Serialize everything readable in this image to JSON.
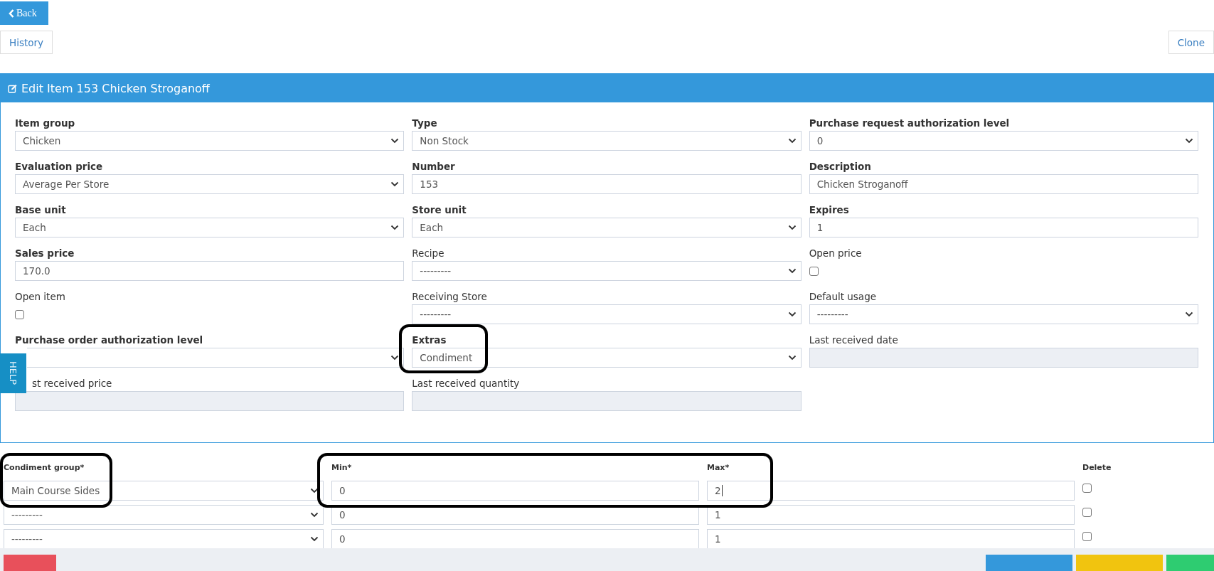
{
  "back_button": {
    "label": "Back"
  },
  "top_actions": [
    {
      "label": "History"
    },
    {
      "label": "Clone"
    }
  ],
  "panel": {
    "title": "Edit Item 153 Chicken Stroganoff",
    "fields": [
      {
        "label": "Item group",
        "required": true,
        "kind": "select",
        "value": "Chicken"
      },
      {
        "label": "Type",
        "required": true,
        "kind": "select",
        "value": "Non Stock"
      },
      {
        "label": "Purchase request authorization level",
        "required": true,
        "kind": "select",
        "value": "0"
      },
      {
        "label": "Evaluation price",
        "required": true,
        "kind": "select",
        "value": "Average Per Store"
      },
      {
        "label": "Number",
        "required": true,
        "kind": "text",
        "value": "153"
      },
      {
        "label": "Description",
        "required": true,
        "kind": "text",
        "value": "Chicken Stroganoff"
      },
      {
        "label": "Base unit",
        "required": true,
        "kind": "select",
        "value": "Each"
      },
      {
        "label": "Store unit",
        "required": true,
        "kind": "select",
        "value": "Each"
      },
      {
        "label": "Expires",
        "required": true,
        "kind": "text",
        "value": "1"
      },
      {
        "label": "Sales price",
        "required": true,
        "kind": "text",
        "value": "170.0"
      },
      {
        "label": "Recipe",
        "required": false,
        "kind": "select",
        "value": "---------"
      },
      {
        "label": "Open price",
        "required": false,
        "kind": "checkbox",
        "checked": false
      },
      {
        "label": "Open item",
        "required": false,
        "kind": "checkbox",
        "checked": false
      },
      {
        "label": "Receiving Store",
        "required": false,
        "kind": "select",
        "value": "---------"
      },
      {
        "label": "Default usage",
        "required": false,
        "kind": "select",
        "value": "---------"
      },
      {
        "label": "Purchase order authorization level",
        "required": true,
        "kind": "select"
      },
      {
        "label": "Extras",
        "required": true,
        "kind": "select",
        "value": "Condiment",
        "highlighted": true
      },
      {
        "label": "Last received date",
        "required": false,
        "kind": "readonly"
      },
      {
        "label": "st received price",
        "required": false,
        "kind": "readonly"
      },
      {
        "label": "Last received quantity",
        "required": false,
        "kind": "readonly"
      }
    ]
  },
  "help_tab": {
    "label": "HELP"
  },
  "condiments": {
    "columns": [
      {
        "label": "Condiment group*",
        "kind": "select",
        "highlighted": true
      },
      {
        "label": "Min*",
        "kind": "text",
        "highlighted": true
      },
      {
        "label": "Max*",
        "kind": "text",
        "highlighted": true
      },
      {
        "label": "Delete",
        "kind": "checkbox",
        "highlighted": false
      }
    ],
    "rows": [
      {
        "group": "Main Course Sides",
        "min": "0",
        "max": "2",
        "delete": false,
        "focused_max": true
      },
      {
        "group": "---------",
        "min": "0",
        "max": "1",
        "delete": false,
        "focused_max": false
      },
      {
        "group": "---------",
        "min": "0",
        "max": "1",
        "delete": false,
        "focused_max": false
      }
    ]
  },
  "footer_buttons": [
    {
      "color": "#e8505b"
    },
    {
      "color": "#3498db"
    },
    {
      "color": "#f1c40f"
    },
    {
      "color": "#2ecc71"
    }
  ]
}
